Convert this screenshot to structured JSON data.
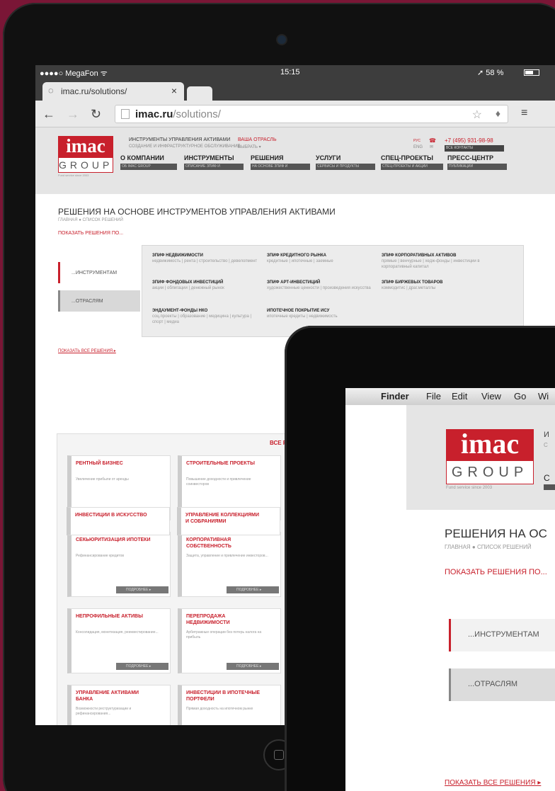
{
  "ipad": {
    "status": {
      "carrier": "●●●●○ MegaFon ᯤ",
      "time": "15:15",
      "battery": "➚ 58 %"
    },
    "tab": {
      "title": "imac.ru/solutions/",
      "close": "×"
    },
    "url": {
      "domain": "imac.ru",
      "path": "/solutions/"
    },
    "header": {
      "logo_top": "imac",
      "logo_bottom": "GROUP",
      "logo_since": "Fund service since 2003",
      "tagline1": "ИНСТРУМЕНТЫ УПРАВЛЕНИЯ АКТИВАМИ",
      "tagline1_sub": "СОЗДАНИЕ И ИНФРАСТРУКТУРНОЕ ОБСЛУЖИВАНИЕ",
      "tagline2": "ВАША ОТРАСЛЬ",
      "tagline2_sub": "ВЫБРАТЬ ▾",
      "lang_ru": "РУС",
      "lang_en": "ENG",
      "phone": "+7 (495) 931-98-98",
      "contacts": "ВСЕ КОНТАКТЫ",
      "menu": [
        {
          "label": "О КОМПАНИИ",
          "sub": "ОБ IMAC GROUP"
        },
        {
          "label": "ИНСТРУМЕНТЫ",
          "sub": "ОПИСАНИЕ ЗПИФ И"
        },
        {
          "label": "РЕШЕНИЯ",
          "sub": "НА ОСНОВЕ ЗПИФ И"
        },
        {
          "label": "УСЛУГИ",
          "sub": "СЕРВИСЫ И ПРОДУКТЫ"
        },
        {
          "label": "СПЕЦ-ПРОЕКТЫ",
          "sub": "СПЕЦ-ПРОЕКТЫ И АКЦИИ"
        },
        {
          "label": "ПРЕСС-ЦЕНТР",
          "sub": "ПУБЛИКАЦИИ"
        }
      ]
    },
    "title": "РЕШЕНИЯ НА ОСНОВЕ ИНСТРУМЕНТОВ УПРАВЛЕНИЯ АКТИВАМИ",
    "crumb": "ГЛАВНАЯ ● СПИСОК РЕШЕНИЙ",
    "show_by": "ПОКАЗАТЬ РЕШЕНИЯ ПО...",
    "side": [
      "...ИНСТРУМЕНТАМ",
      "...ОТРАСЛЯМ"
    ],
    "solutions": [
      {
        "t": "ЗПИФ НЕДВИЖИМОСТИ",
        "d": "недвижимость | рента | строительство | девелопмент"
      },
      {
        "t": "ЗПИФ КРЕДИТНОГО РЫНКА",
        "d": "кредитные | ипотечные | заемные"
      },
      {
        "t": "ЗПИФ КОРПОРАТИВНЫХ АКТИВОВ",
        "d": "прямые | венчурные | хедж-фонды | инвестиции в корпоративный капитал"
      },
      {
        "t": "ЗПИФ ФОНДОВЫХ ИНВЕСТИЦИЙ",
        "d": "акции | облигации | денежный рынок"
      },
      {
        "t": "ЗПИФ АРТ-ИНВЕСТИЦИЙ",
        "d": "художественные ценности | произведения искусства"
      },
      {
        "t": "ЗПИФ БИРЖЕВЫХ ТОВАРОВ",
        "d": "коммодитис | драг.металлы"
      },
      {
        "t": "ЭНДАУМЕНТ-ФОНДЫ НКО",
        "d": "соц.проекты | образование | медицина | культура | спорт | медиа"
      },
      {
        "t": "ИПОТЕЧНОЕ ПОКРЫТИЕ ИСУ",
        "d": "ипотечные кредиты | недвижимость"
      }
    ],
    "show_all": "ПОКАЗАТЬ ВСЕ РЕШЕНИЯ ▸",
    "all_label": "ВСЕ РЕШ",
    "more": "ПОДРОБНЕЕ ▸",
    "cards": [
      {
        "t": "РЕНТНЫЙ БИЗНЕС",
        "d": "Увеличение прибыли от аренды"
      },
      {
        "t": "СТРОИТЕЛЬНЫЕ ПРОЕКТЫ",
        "d": "Повышение доходности и привлечение соинвесторов"
      },
      {
        "t": "СЕКЬЮРИТИЗАЦИЯ ИПОТЕКИ",
        "d": "Рефинансирование кредитов"
      },
      {
        "t": "КОРПОРАТИВНАЯ СОБСТВЕННОСТЬ",
        "d": "Защита, управление и привлечение инвесторов..."
      },
      {
        "t": "НЕПРОФИЛЬНЫЕ АКТИВЫ",
        "d": "Консолидация, монетизация, реинвестирование..."
      },
      {
        "t": "ПЕРЕПРОДАЖА НЕДВИЖИМОСТИ",
        "d": "Арбитражные операции без потерь налога на прибыль"
      },
      {
        "t": "УПРАВЛЕНИЕ АКТИВАМИ БАНКА",
        "d": "Возможности реструктуризации и рефинансирования..."
      },
      {
        "t": "ИНВЕСТИЦИИ В ИПОТЕЧНЫЕ ПОРТФЕЛИ",
        "d": "Прямая доходность на ипотечном рынке"
      },
      {
        "t": "ИНВЕСТИЦИИ В ИСКУССТВО",
        "d": ""
      },
      {
        "t": "УПРАВЛЕНИЕ КОЛЛЕКЦИЯМИ И СОБРАНИЯМИ",
        "d": ""
      }
    ]
  },
  "mac": {
    "menubar": [
      "Finder",
      "File",
      "Edit",
      "View",
      "Go",
      "Wi"
    ],
    "tagline": "И",
    "tagline_sub": "С",
    "menu0": "С",
    "title": "РЕШЕНИЯ НА ОС",
    "crumb": "ГЛАВНАЯ ● СПИСОК РЕШЕНИЙ",
    "show_by": "ПОКАЗАТЬ РЕШЕНИЯ ПО...",
    "side": [
      "...ИНСТРУМЕНТАМ",
      "...ОТРАСЛЯМ"
    ],
    "show_all": "ПОКАЗАТЬ ВСЕ РЕШЕНИЯ ▸"
  }
}
